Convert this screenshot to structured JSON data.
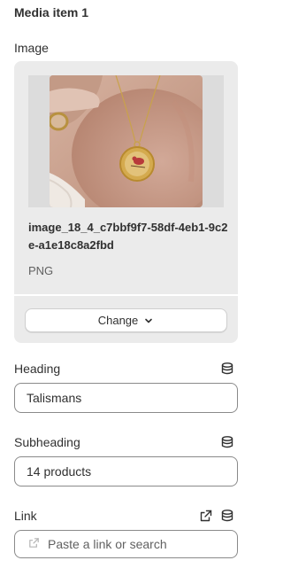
{
  "section": {
    "title": "Media item 1"
  },
  "image_field": {
    "label": "Image",
    "file_name": "image_18_4_c7bbf9f7-58df-4eb1-9c2e-a1e18c8a2fbd",
    "file_type": "PNG",
    "change_label": "Change",
    "thumbnail_alt": "Gold necklace with round cardinal pendant"
  },
  "heading_field": {
    "label": "Heading",
    "value": "Talismans"
  },
  "subheading_field": {
    "label": "Subheading",
    "value": "14 products"
  },
  "link_field": {
    "label": "Link",
    "placeholder": "Paste a link or search",
    "value": ""
  },
  "icons": {
    "dynamic_source": "database-icon",
    "external_link": "external-link-icon",
    "link_field_icon": "link-icon",
    "change_chevron": "chevron-down-icon"
  },
  "colors": {
    "text": "#303030",
    "muted_text": "#616161",
    "card_background": "#ebebeb",
    "input_border": "#8a8a8a"
  }
}
